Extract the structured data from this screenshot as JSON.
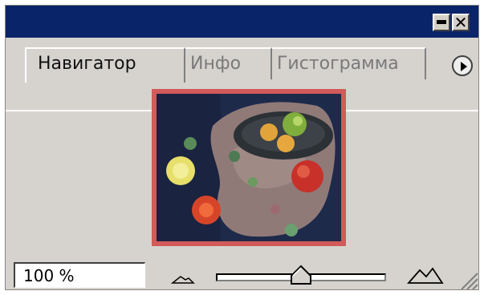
{
  "window": {
    "minimize_icon": "minimize-icon",
    "close_icon": "close-icon",
    "close_glyph": "✕"
  },
  "tabs": [
    {
      "label": "Навигатор",
      "active": true
    },
    {
      "label": "Инфо",
      "active": false
    },
    {
      "label": "Гистограмма",
      "active": false
    }
  ],
  "panel_menu_icon": "play-arrow-circle-icon",
  "preview": {
    "frame_color": "#d25a5a",
    "visible_area_note_icon": "navigator-preview-image"
  },
  "zoom": {
    "value": "100 %",
    "slider_level": 0.48,
    "zoom_out_icon": "small-mountain-icon",
    "zoom_in_icon": "large-mountain-icon"
  },
  "colors": {
    "title_bar": "#0a246a",
    "panel_bg": "#d6d3ce"
  }
}
